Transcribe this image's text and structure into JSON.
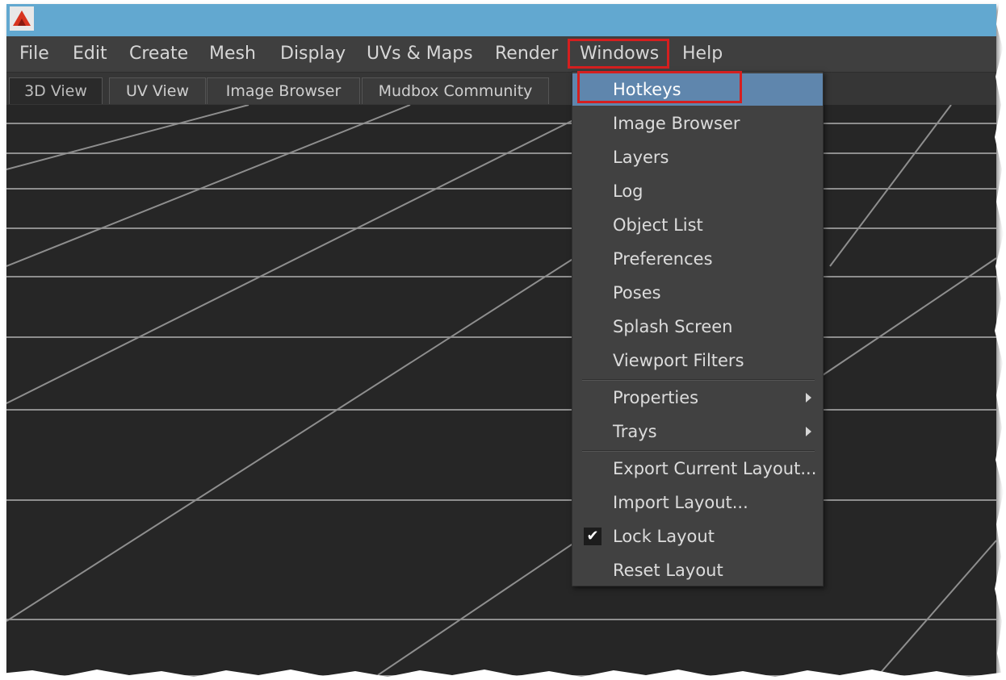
{
  "app": {
    "icon": "mudbox-logo-icon"
  },
  "menubar": {
    "items": [
      "File",
      "Edit",
      "Create",
      "Mesh",
      "Display",
      "UVs & Maps",
      "Render",
      "Windows",
      "Help"
    ],
    "active": "Windows"
  },
  "tabs": {
    "items": [
      "3D View",
      "UV View",
      "Image Browser",
      "Mudbox Community"
    ],
    "active": "3D View"
  },
  "windows_menu": {
    "items": [
      {
        "label": "Hotkeys",
        "selected": true
      },
      {
        "label": "Image Browser"
      },
      {
        "label": "Layers"
      },
      {
        "label": "Log"
      },
      {
        "label": "Object List"
      },
      {
        "label": "Preferences"
      },
      {
        "label": "Poses"
      },
      {
        "label": "Splash Screen"
      },
      {
        "label": "Viewport Filters"
      },
      {
        "label": "Properties",
        "submenu": true
      },
      {
        "label": "Trays",
        "submenu": true
      },
      {
        "label": "Export Current Layout..."
      },
      {
        "label": "Import Layout..."
      },
      {
        "label": "Lock Layout",
        "checked": true
      },
      {
        "label": "Reset Layout"
      }
    ]
  },
  "colors": {
    "titlebar": "#62a8d0",
    "highlight_box": "#d51f1f",
    "selected_item": "#5f86ad",
    "viewport_bg": "#262626",
    "grid": "#8e8e8e"
  }
}
